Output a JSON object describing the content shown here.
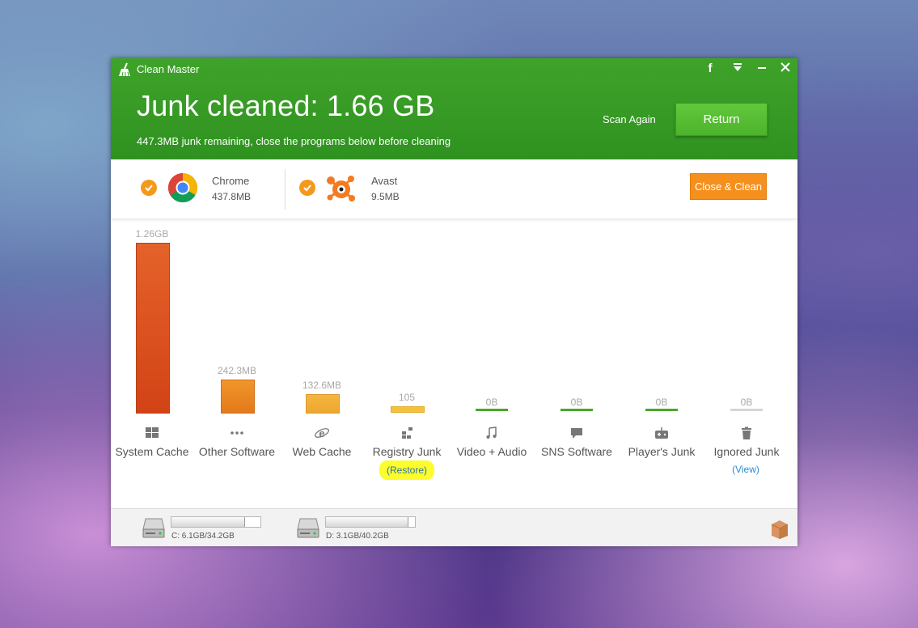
{
  "window": {
    "app_title": "Clean Master",
    "controls": [
      "facebook-icon",
      "menu-dropdown-icon",
      "minimize-icon",
      "close-icon"
    ]
  },
  "header": {
    "headline": "Junk cleaned: 1.66 GB",
    "subline": "447.3MB junk remaining, close the programs below before cleaning",
    "scan_again": "Scan Again",
    "return_label": "Return"
  },
  "processes": {
    "items": [
      {
        "name": "Chrome",
        "size": "437.8MB",
        "checked": true,
        "icon": "chrome-icon"
      },
      {
        "name": "Avast",
        "size": "9.5MB",
        "checked": true,
        "icon": "avast-icon"
      }
    ],
    "close_clean_label": "Close & Clean"
  },
  "categories": {
    "items": [
      {
        "label": "System Cache",
        "value": "1.26GB",
        "icon": "windows-icon",
        "color": "#d94a20"
      },
      {
        "label": "Other Software",
        "value": "242.3MB",
        "icon": "ellipsis-icon",
        "color": "#ea8a1e"
      },
      {
        "label": "Web Cache",
        "value": "132.6MB",
        "icon": "ie-icon",
        "color": "#f1ad35"
      },
      {
        "label": "Registry Junk",
        "value": "105",
        "icon": "registry-icon",
        "color": "#f4c23c"
      },
      {
        "label": "Video + Audio",
        "value": "0B",
        "icon": "music-note-icon",
        "color": "#4aa62a"
      },
      {
        "label": "SNS Software",
        "value": "0B",
        "icon": "chat-bubble-icon",
        "color": "#4aa62a"
      },
      {
        "label": "Player's Junk",
        "value": "0B",
        "icon": "gamepad-icon",
        "color": "#4aa62a"
      },
      {
        "label": "Ignored Junk",
        "value": "0B",
        "icon": "trash-icon",
        "color": "#d6d6d6"
      }
    ],
    "restore_link": "(Restore)",
    "view_link": "(View)"
  },
  "drives": [
    {
      "label": "C: 6.1GB/34.2GB",
      "used_fraction": 0.82,
      "icon": "hard-drive-icon"
    },
    {
      "label": "D: 3.1GB/40.2GB",
      "used_fraction": 0.92,
      "icon": "hard-drive-icon"
    }
  ],
  "footer": {
    "icon": "box-icon"
  }
}
